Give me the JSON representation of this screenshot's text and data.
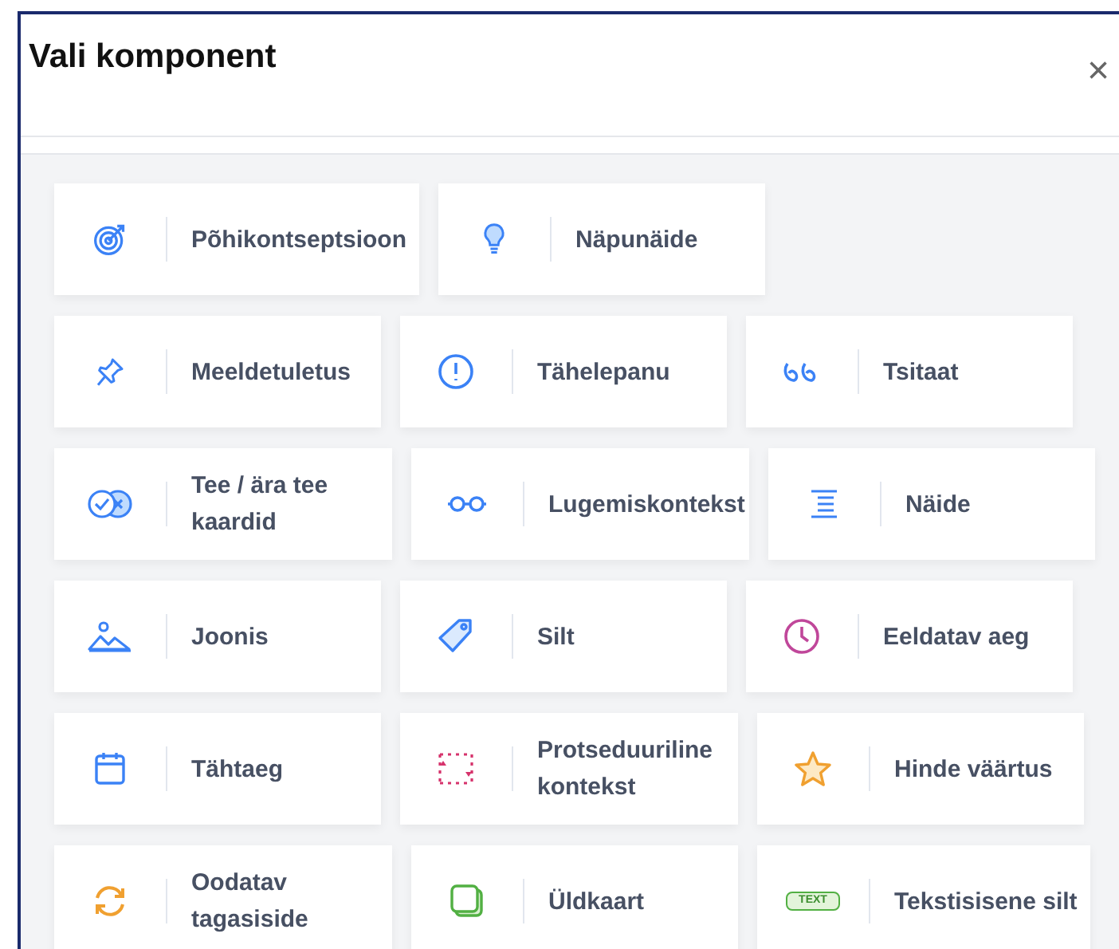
{
  "dialog": {
    "title": "Vali komponent",
    "close": "×"
  },
  "rows": [
    [
      {
        "label": "Põhikontseptsioon"
      },
      {
        "label": "Näpunäide"
      }
    ],
    [
      {
        "label": "Meeldetuletus"
      },
      {
        "label": "Tähelepanu"
      },
      {
        "label": "Tsitaat"
      }
    ],
    [
      {
        "label": "Tee / ära tee kaardid"
      },
      {
        "label": "Lugemiskontekst"
      },
      {
        "label": "Näide"
      }
    ],
    [
      {
        "label": "Joonis"
      },
      {
        "label": "Silt"
      },
      {
        "label": "Eeldatav aeg"
      }
    ],
    [
      {
        "label": "Tähtaeg"
      },
      {
        "label": "Protseduuriline kontekst"
      },
      {
        "label": "Hinde väärtus"
      }
    ],
    [
      {
        "label": "Oodatav tagasiside"
      },
      {
        "label": "Üldkaart"
      },
      {
        "label": "Tekstisisene silt",
        "badge": "TEXT"
      }
    ]
  ]
}
